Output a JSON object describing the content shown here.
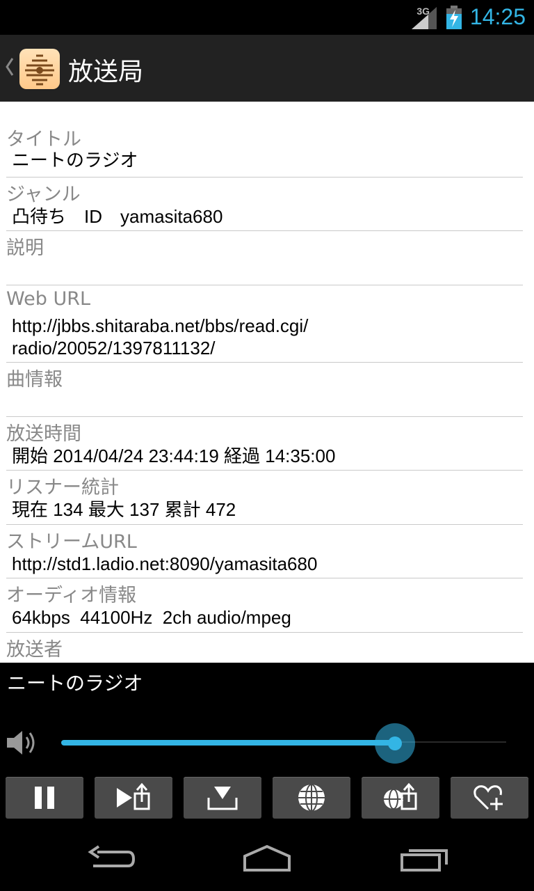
{
  "status_bar": {
    "network": "3G",
    "time": "14:25"
  },
  "action_bar": {
    "title": "放送局"
  },
  "fields": [
    {
      "label": "タイトル",
      "value": "ニートのラジオ"
    },
    {
      "label": "ジャンル",
      "value": "凸待ち　ID　yamasita680"
    },
    {
      "label": "説明",
      "value": ""
    },
    {
      "label": "Web URL",
      "value": "http://jbbs.shitaraba.net/bbs/read.cgi/\nradio/20052/1397811132/"
    },
    {
      "label": "曲情報",
      "value": ""
    },
    {
      "label": "放送時間",
      "value": "開始 2014/04/24 23:44:19 経過 14:35:00"
    },
    {
      "label": "リスナー統計",
      "value": "現在 134 最大 137 累計 472"
    },
    {
      "label": "ストリームURL",
      "value": "http://std1.ladio.net:8090/yamasita680"
    },
    {
      "label": "オーディオ情報",
      "value": "64kbps  44100Hz  2ch audio/mpeg"
    },
    {
      "label": "放送者",
      "value": ""
    }
  ],
  "player": {
    "now_playing": "ニートのラジオ",
    "volume_fraction": 0.75,
    "accent_color": "#33b5e5",
    "buttons": [
      "pause-icon",
      "play-share-icon",
      "download-icon",
      "globe-icon",
      "globe-share-icon",
      "heart-add-icon"
    ]
  },
  "nav_bar": {
    "buttons": [
      "back-icon",
      "home-icon",
      "recent-apps-icon"
    ]
  }
}
